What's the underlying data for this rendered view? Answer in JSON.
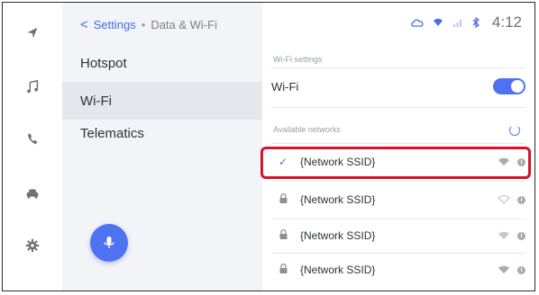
{
  "rail": {
    "items": [
      {
        "name": "navigation-icon"
      },
      {
        "name": "music-icon"
      },
      {
        "name": "phone-icon"
      },
      {
        "name": "car-icon"
      },
      {
        "name": "settings-gear-icon"
      }
    ]
  },
  "menu": {
    "breadcrumb": {
      "back": "<",
      "section": "Settings",
      "separator": "•",
      "current": "Data & Wi-Fi"
    },
    "items": [
      {
        "label": "Hotspot"
      },
      {
        "label": "Wi-Fi"
      },
      {
        "label": "Telematics"
      }
    ]
  },
  "status": {
    "time": "4:12"
  },
  "panel": {
    "wifi_settings_label": "Wi-Fi settings",
    "wifi_label": "Wi-Fi",
    "wifi_enabled": true,
    "available_networks_label": "Available networks",
    "networks": [
      {
        "ssid": "{Network SSID}",
        "connected": true
      },
      {
        "ssid": "{Network SSID}",
        "connected": false
      },
      {
        "ssid": "{Network SSID}",
        "connected": false
      },
      {
        "ssid": "{Network SSID}",
        "connected": false
      }
    ]
  },
  "colors": {
    "accent": "#4e72f0",
    "highlight": "#d5142c"
  }
}
